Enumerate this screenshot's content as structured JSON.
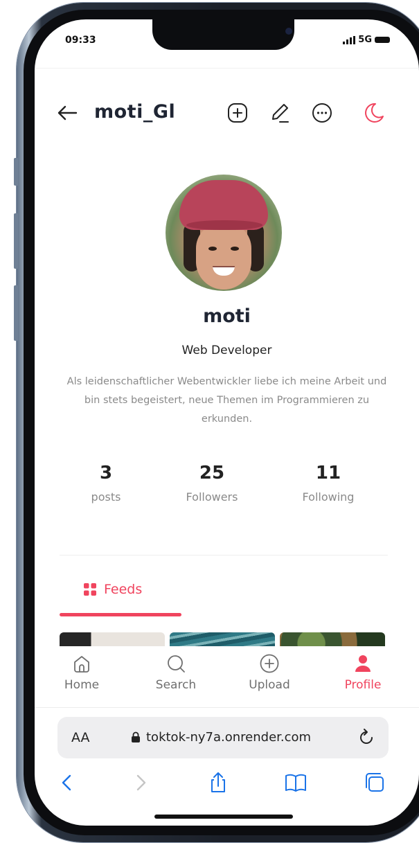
{
  "status_bar": {
    "time": "09:33",
    "network": "5G"
  },
  "header": {
    "username": "moti_Gl"
  },
  "profile": {
    "name": "moti",
    "role": "Web Developer",
    "bio": "Als leidenschaftlicher Webentwickler liebe ich meine Arbeit und bin stets begeistert, neue Themen im Programmieren zu erkunden."
  },
  "stats": [
    {
      "value": "3",
      "label": "posts"
    },
    {
      "value": "25",
      "label": "Followers"
    },
    {
      "value": "11",
      "label": "Following"
    }
  ],
  "tabs": {
    "feeds": "Feeds"
  },
  "bottom_nav": [
    {
      "label": "Home",
      "icon": "home-icon"
    },
    {
      "label": "Search",
      "icon": "search-icon"
    },
    {
      "label": "Upload",
      "icon": "plus-circle-icon"
    },
    {
      "label": "Profile",
      "icon": "user-icon",
      "active": true
    }
  ],
  "browser": {
    "aa": "AA",
    "url": "toktok-ny7a.onrender.com"
  },
  "colors": {
    "accent": "#f0445e",
    "text_dark": "#1f2533",
    "muted": "#8a8a8a",
    "browser_blue": "#1a73e8"
  }
}
